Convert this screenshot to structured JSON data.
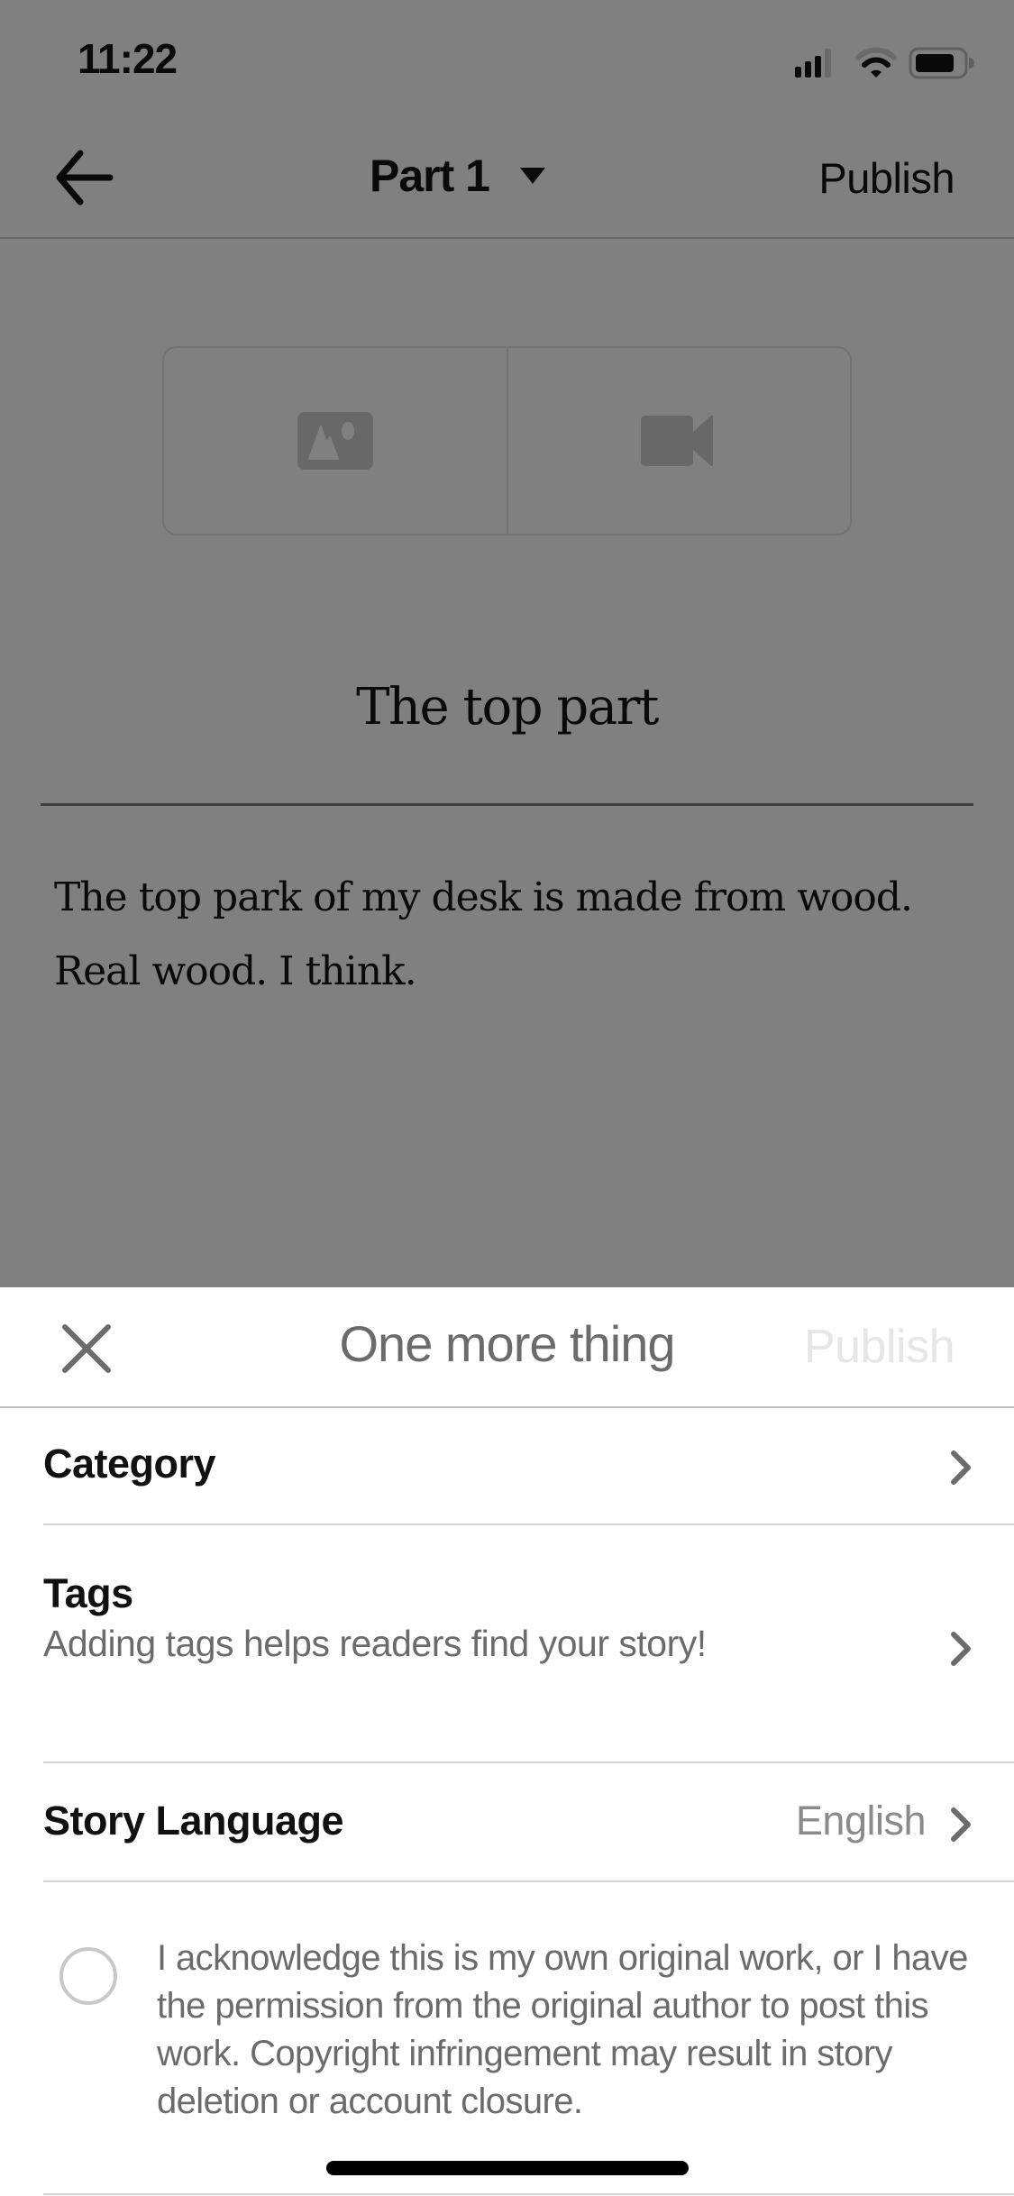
{
  "status_bar": {
    "time": "11:22",
    "icons": [
      "cellular-signal-icon",
      "wifi-icon",
      "battery-icon"
    ]
  },
  "editor": {
    "nav": {
      "back_icon": "arrow-left-icon",
      "part_title": "Part 1",
      "part_dropdown_icon": "caret-down-icon",
      "publish_label": "Publish"
    },
    "media_buttons": [
      {
        "name": "add-image",
        "icon": "image-icon"
      },
      {
        "name": "add-video",
        "icon": "video-camera-icon"
      }
    ],
    "story_title": "The top part",
    "story_body": "The top park of my desk is made from wood. Real wood. I think."
  },
  "sheet": {
    "close_icon": "close-icon",
    "title": "One more thing",
    "publish_label": "Publish",
    "publish_enabled": false,
    "rows": [
      {
        "label": "Category",
        "subtitle": "",
        "value": ""
      },
      {
        "label": "Tags",
        "subtitle": "Adding tags helps readers find your story!",
        "value": ""
      },
      {
        "label": "Story Language",
        "subtitle": "",
        "value": "English"
      }
    ],
    "acknowledgement": {
      "checked": false,
      "text": "I acknowledge this is my own original work, or I have the permission from the original author to post this work. Copyright infringement may result in story deletion or account closure."
    }
  },
  "colors": {
    "overlay_background": "#808080",
    "sheet_background": "#ffffff",
    "sheet_title": "#6b6b6b",
    "disabled_publish": "#e6e6e6",
    "secondary_text": "#6b6b6b",
    "radio_border": "#c8c8cc"
  }
}
